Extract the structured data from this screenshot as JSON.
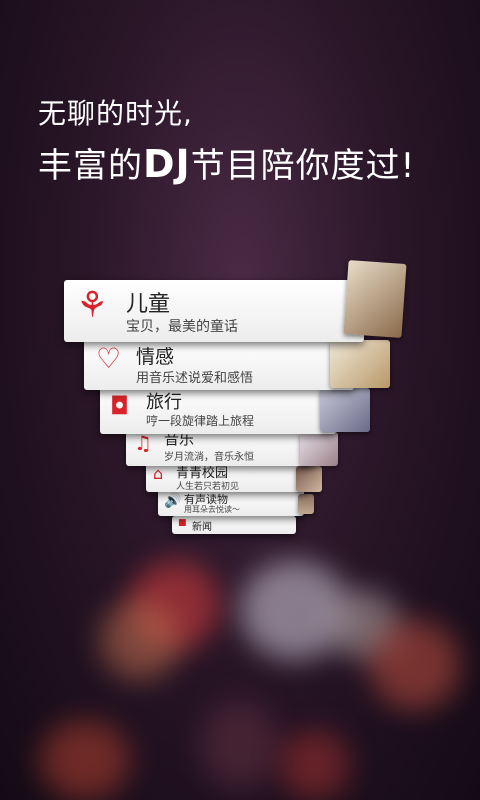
{
  "headline": {
    "line1": "无聊的时光,",
    "line2_prefix": "丰富的",
    "line2_dj": "DJ",
    "line2_suffix": "节目陪你度过!"
  },
  "categories": [
    {
      "title": "儿童",
      "subtitle": "宝贝，最美的童话",
      "icon": "stroller-icon"
    },
    {
      "title": "情感",
      "subtitle": "用音乐述说爱和感悟",
      "icon": "heart-icon"
    },
    {
      "title": "旅行",
      "subtitle": "哼一段旋律踏上旅程",
      "icon": "camera-icon"
    },
    {
      "title": "音乐",
      "subtitle": "岁月流淌，音乐永恒",
      "icon": "music-note-icon"
    },
    {
      "title": "青青校园",
      "subtitle": "人生若只若初见",
      "icon": "school-icon"
    },
    {
      "title": "有声读物",
      "subtitle": "用耳朵去悦读～",
      "icon": "speaker-icon"
    },
    {
      "title": "新闻",
      "subtitle": "",
      "icon": "news-icon"
    }
  ],
  "colors": {
    "accent": "#d8232a"
  }
}
